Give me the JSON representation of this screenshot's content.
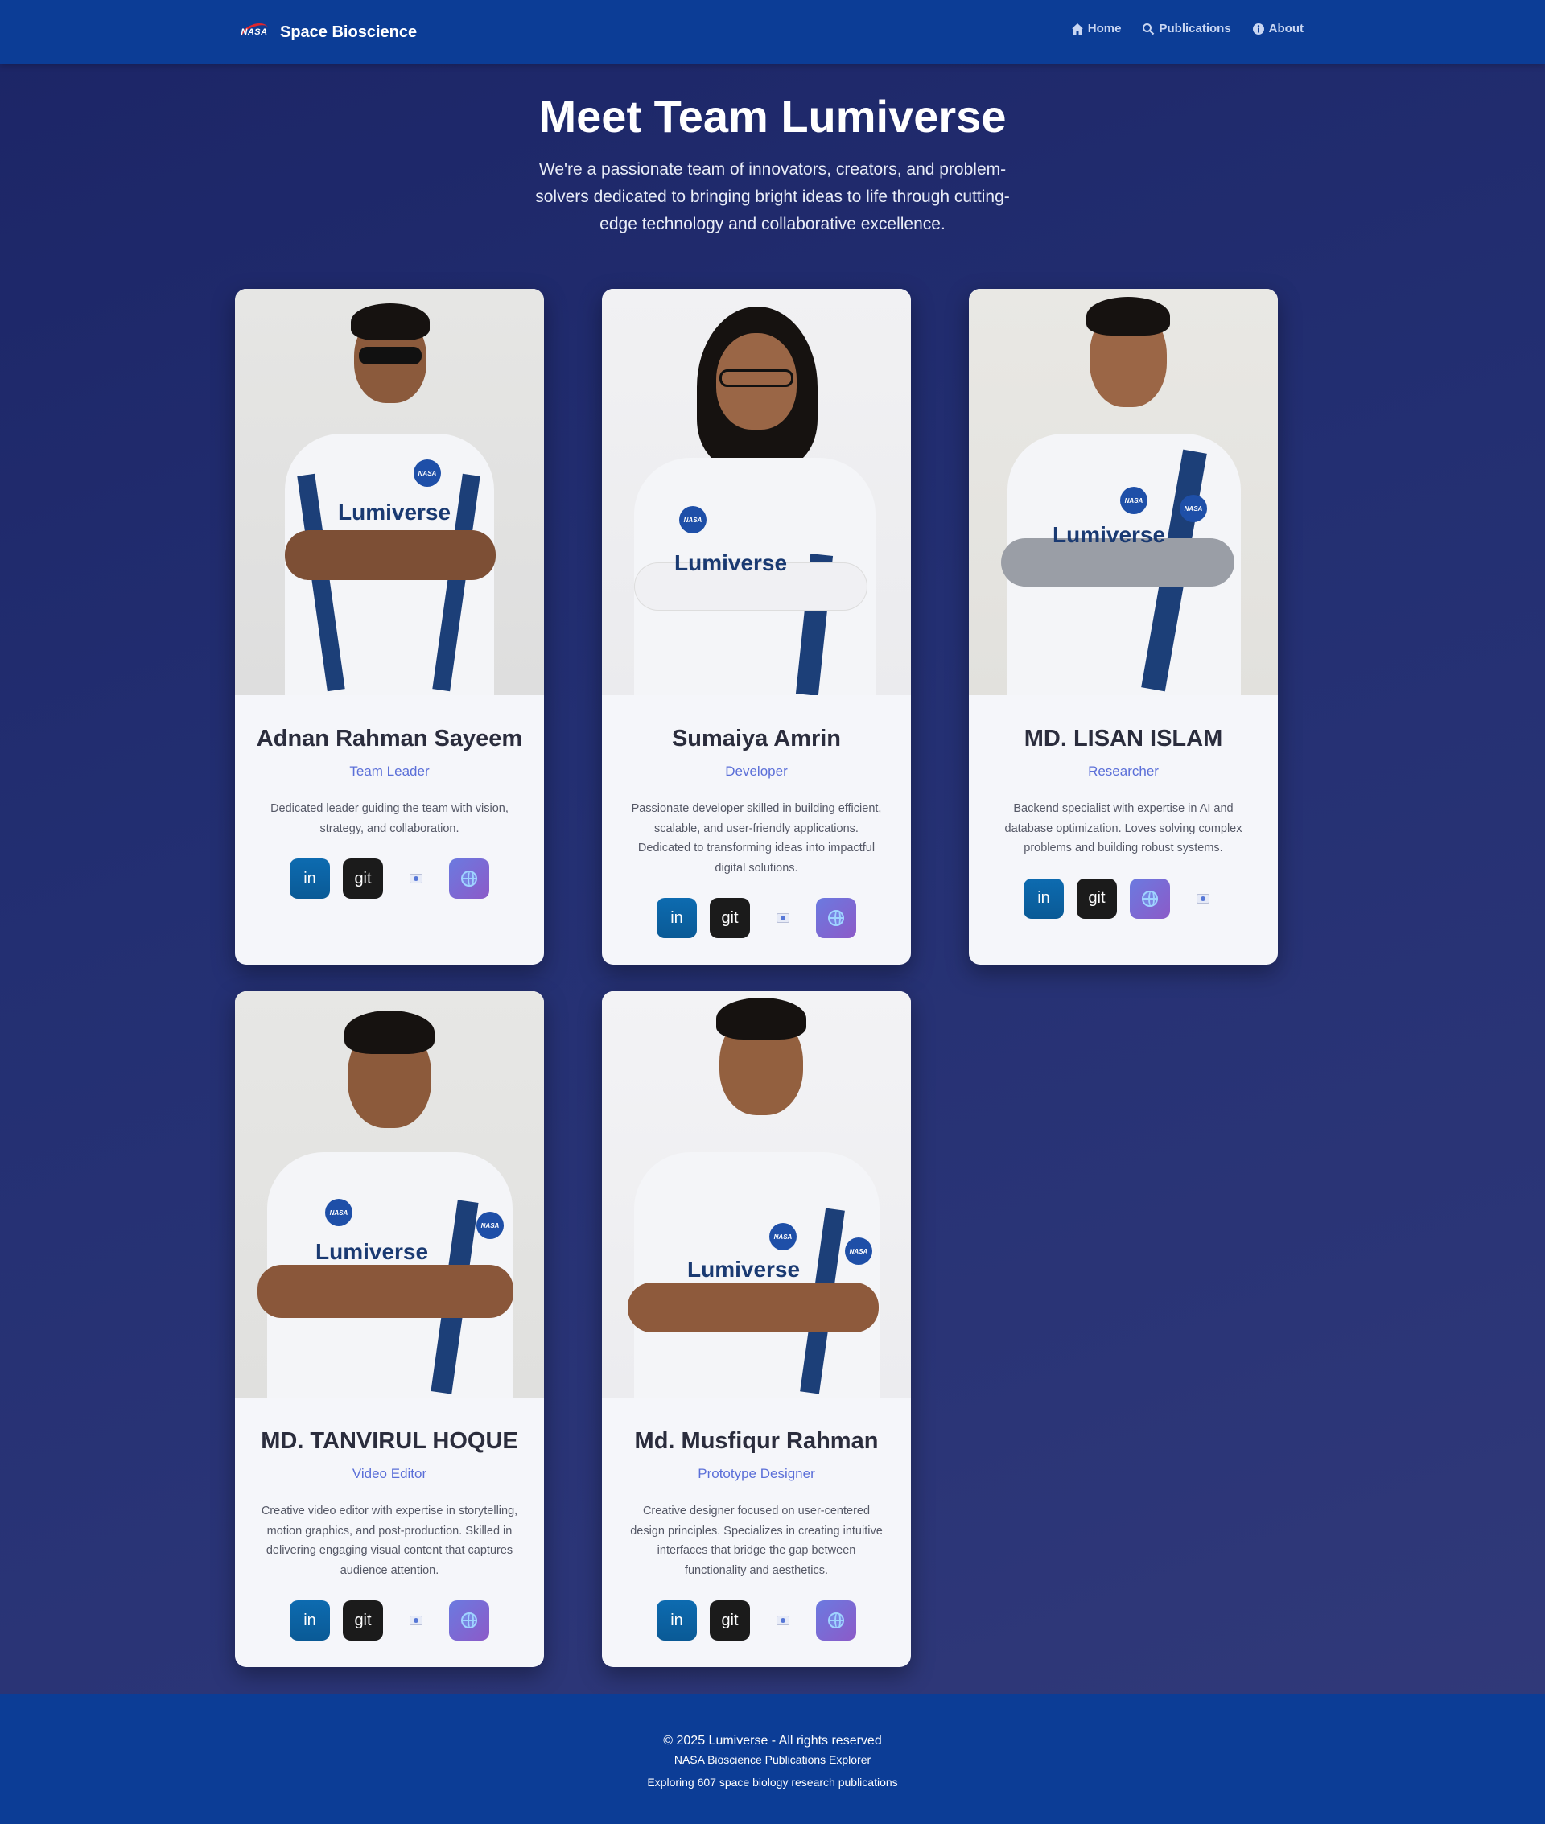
{
  "nav": {
    "brand": "Space Bioscience",
    "logo_text": "NASA",
    "links": [
      {
        "label": "Home",
        "icon": "home-icon"
      },
      {
        "label": "Publications",
        "icon": "search-icon"
      },
      {
        "label": "About",
        "icon": "info-icon"
      }
    ]
  },
  "hero": {
    "title": "Meet Team Lumiverse",
    "description": "We're a passionate team of innovators, creators, and problem-solvers dedicated to bringing bright ideas to life through cutting-edge technology and collaborative excellence."
  },
  "team": [
    {
      "name": "Adnan Rahman Sayeem",
      "role": "Team Leader",
      "bio": "Dedicated leader guiding the team with vision, strategy, and collaboration.",
      "socials": [
        "in",
        "git",
        "img",
        "web"
      ]
    },
    {
      "name": "Sumaiya Amrin",
      "role": "Developer",
      "bio": "Passionate developer skilled in building efficient, scalable, and user-friendly applications. Dedicated to transforming ideas into impactful digital solutions.",
      "socials": [
        "in",
        "git",
        "img",
        "web"
      ]
    },
    {
      "name": "MD. LISAN ISLAM",
      "role": "Researcher",
      "bio": "Backend specialist with expertise in AI and database optimization. Loves solving complex problems and building robust systems.",
      "socials": [
        "in",
        "git",
        "web",
        "img"
      ]
    },
    {
      "name": "MD. TANVIRUL HOQUE",
      "role": "Video Editor",
      "bio": "Creative video editor with expertise in storytelling, motion graphics, and post-production. Skilled in delivering engaging visual content that captures audience attention.",
      "socials": [
        "in",
        "git",
        "img",
        "web"
      ]
    },
    {
      "name": "Md. Musfiqur Rahman",
      "role": "Prototype Designer",
      "bio": "Creative designer focused on user-centered design principles. Specializes in creating intuitive interfaces that bridge the gap between functionality and aesthetics.",
      "socials": [
        "in",
        "git",
        "img",
        "web"
      ]
    }
  ],
  "jersey_text": "Lumiverse",
  "social_labels": {
    "in": "in",
    "git": "git"
  },
  "footer": {
    "copyright": "© 2025 Lumiverse - All rights reserved",
    "subtitle": "NASA Bioscience Publications Explorer",
    "tagline": "Exploring 607 space biology research publications"
  },
  "colors": {
    "navbar": "#0c3d96",
    "accent": "#5b6fd8",
    "linkedin": "#0a66c2",
    "github": "#1b1b1b"
  }
}
